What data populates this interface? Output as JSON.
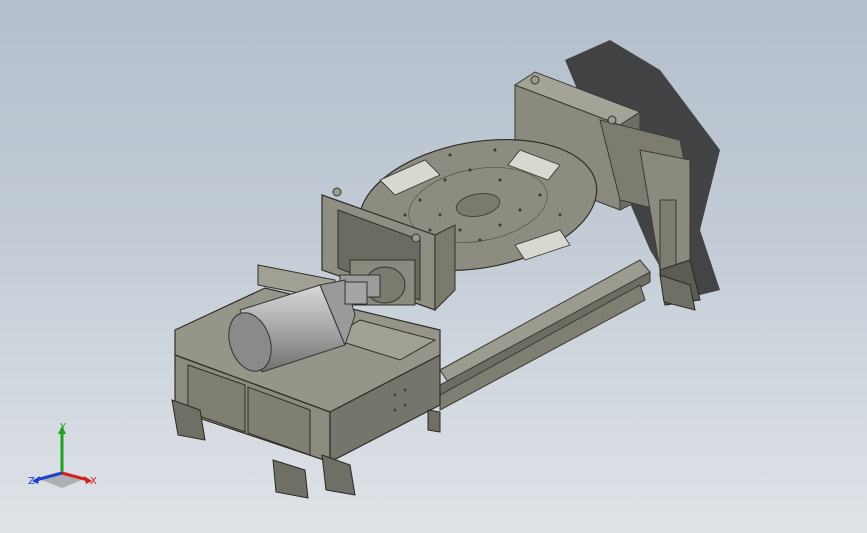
{
  "viewport": {
    "background_top": "#b4bfcc",
    "background_bottom": "#dfe3e8",
    "model_fill": "#8d8d80",
    "model_dark": "#5f5f56",
    "model_light": "#a9a99d",
    "motor_color": "#b8b8b8"
  },
  "triad": {
    "x_label": "X",
    "y_label": "Y",
    "z_label": "Z",
    "x_color": "#d02020",
    "y_color": "#20a020",
    "z_color": "#2040d0"
  },
  "model": {
    "name_icon": "positioner-assembly-icon"
  }
}
